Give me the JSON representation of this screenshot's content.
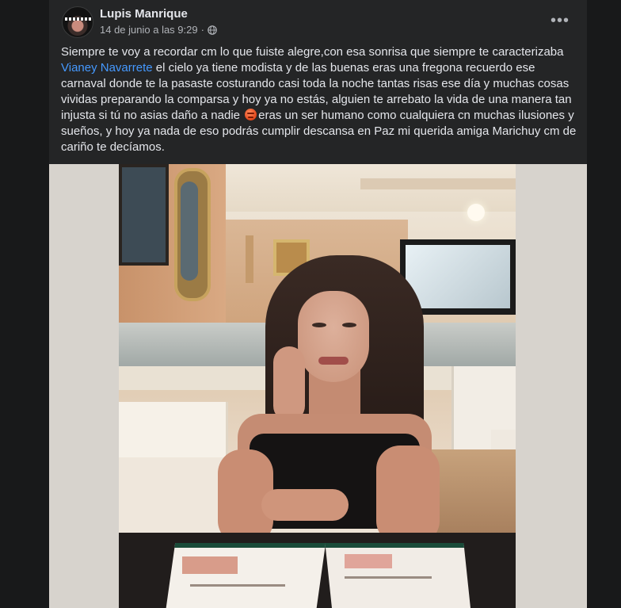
{
  "post": {
    "author": "Lupis Manrique",
    "timestamp": "14 de junio a las 9:29",
    "privacy_icon": "globe-icon",
    "more_label": "•••",
    "text": {
      "part1": "Siempre te voy a recordar cm lo que fuiste alegre,con esa sonrisa que siempre te caracterizaba ",
      "mention": "Vianey Navarrete",
      "part2": " el cielo ya tiene modista y de las buenas eras una fregona recuerdo ese carnaval donde te la pasaste costurando casi toda la noche tantas risas ese día y muchas cosas vividas preparando la comparsa y hoy ya no estás, alguien te arrebato la vida de una manera tan injusta si tú no asias daño a nadie ",
      "emoji": "angry-face-emoji",
      "part3": "eras un ser humano como cualquiera cn muchas ilusiones y sueños, y hoy ya nada de eso podrás  cumplir descansa en Paz mi querida amiga Marichuy cm de cariño te decíamos."
    }
  },
  "colors": {
    "page_bg": "#18191a",
    "card_bg": "#242526",
    "text_primary": "#e4e6eb",
    "text_secondary": "#b0b3b8",
    "mention": "#4599ff"
  }
}
